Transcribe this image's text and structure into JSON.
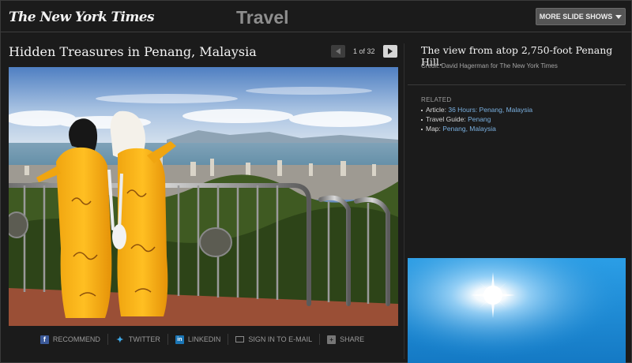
{
  "header": {
    "logo": "The New York Times",
    "section": "Travel",
    "more_button": "MORE SLIDE SHOWS"
  },
  "slideshow": {
    "title": "Hidden Treasures in Penang, Malaysia",
    "pager": {
      "current": 1,
      "total": 32,
      "text": "1 of 32"
    },
    "caption": "The view from atop 2,750-foot Penang Hill.",
    "credit": "Credit: David Hagerman for The New York Times"
  },
  "share": {
    "items": [
      {
        "label": "RECOMMEND",
        "icon": "facebook-icon"
      },
      {
        "label": "TWITTER",
        "icon": "twitter-icon"
      },
      {
        "label": "LINKEDIN",
        "icon": "linkedin-icon"
      },
      {
        "label": "SIGN IN TO E-MAIL",
        "icon": "email-icon"
      },
      {
        "label": "SHARE",
        "icon": "share-icon"
      }
    ]
  },
  "related": {
    "label": "RELATED",
    "items": [
      {
        "prefix": "Article: ",
        "link": "36 Hours: Penang, Malaysia"
      },
      {
        "prefix": "Travel Guide: ",
        "link": "Penang"
      },
      {
        "prefix": "Map: ",
        "link": "Penang, Malaysia"
      }
    ]
  },
  "colors": {
    "background": "#1b1b1b",
    "link": "#7ab0e0",
    "ad_sky": "#1f8fd8"
  }
}
